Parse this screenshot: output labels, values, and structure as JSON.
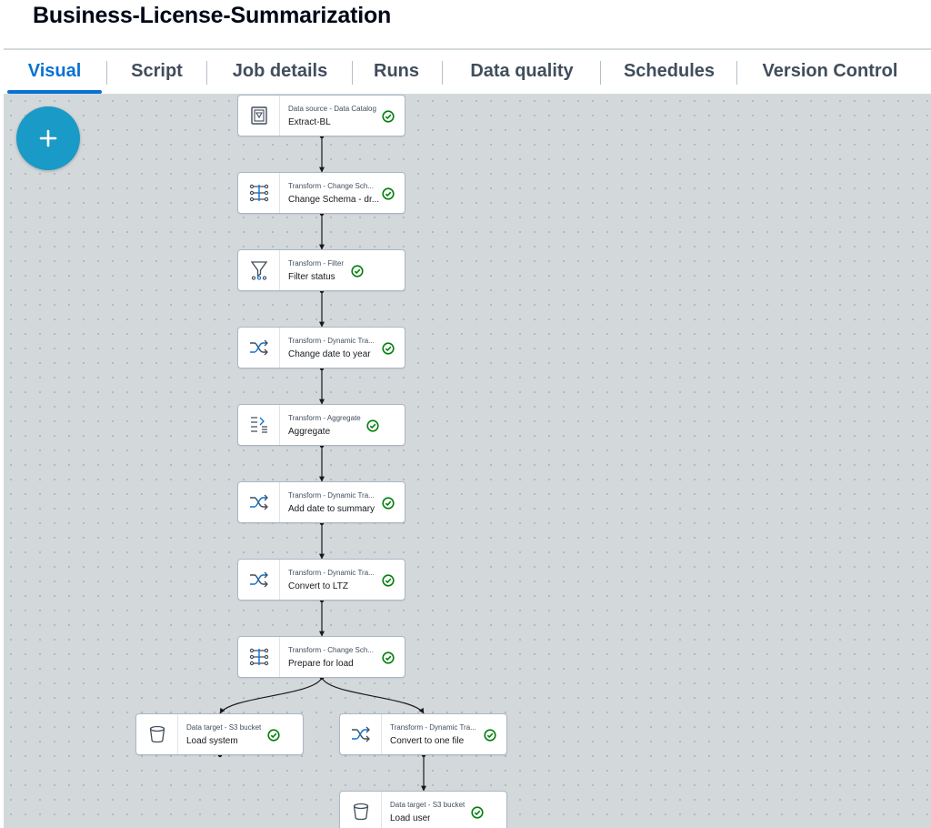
{
  "job": {
    "title": "Business-License-Summarization"
  },
  "tabs": [
    {
      "label": "Visual",
      "active": true
    },
    {
      "label": "Script"
    },
    {
      "label": "Job details"
    },
    {
      "label": "Runs"
    },
    {
      "label": "Data quality"
    },
    {
      "label": "Schedules"
    },
    {
      "label": "Version Control"
    }
  ],
  "canvas": {
    "add_button_icon": "plus-icon"
  },
  "colors": {
    "accent": "#0972d3",
    "success": "#037f0c",
    "add_button": "#1a9ac6",
    "canvas_bg": "#d3d8db"
  },
  "nodes": [
    {
      "type": "Data source - Data Catalog",
      "name": "Extract-BL",
      "icon": "data-catalog-icon",
      "status": "success"
    },
    {
      "type": "Transform - Change Sch...",
      "name": "Change Schema - dr...",
      "icon": "change-schema-icon",
      "status": "success"
    },
    {
      "type": "Transform - Filter",
      "name": "Filter status",
      "icon": "filter-icon",
      "status": "success"
    },
    {
      "type": "Transform - Dynamic Tra...",
      "name": "Change date to year",
      "icon": "dynamic-transform-icon",
      "status": "success"
    },
    {
      "type": "Transform - Aggregate",
      "name": "Aggregate",
      "icon": "aggregate-icon",
      "status": "success"
    },
    {
      "type": "Transform - Dynamic Tra...",
      "name": "Add date to summary",
      "icon": "dynamic-transform-icon",
      "status": "success"
    },
    {
      "type": "Transform - Dynamic Tra...",
      "name": "Convert to LTZ",
      "icon": "dynamic-transform-icon",
      "status": "success"
    },
    {
      "type": "Transform - Change Sch...",
      "name": "Prepare for load",
      "icon": "change-schema-icon",
      "status": "success"
    },
    {
      "type": "Data target - S3 bucket",
      "name": "Load system",
      "icon": "s3-bucket-icon",
      "status": "success"
    },
    {
      "type": "Transform - Dynamic Tra...",
      "name": "Convert to one file",
      "icon": "dynamic-transform-icon",
      "status": "success"
    },
    {
      "type": "Data target - S3 bucket",
      "name": "Load user",
      "icon": "s3-bucket-icon",
      "status": "success"
    }
  ]
}
